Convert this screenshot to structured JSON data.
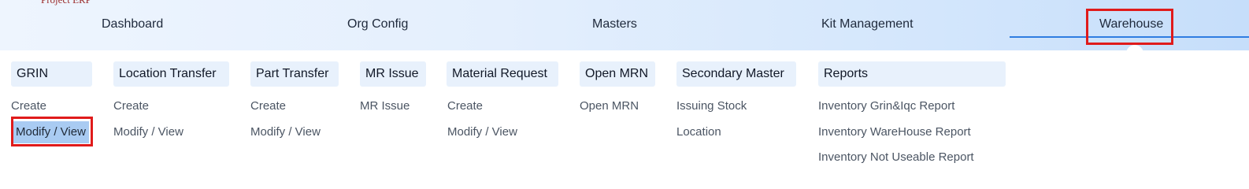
{
  "brand": {
    "logo_text": "Project ERP"
  },
  "nav": {
    "items": [
      {
        "label": "Dashboard"
      },
      {
        "label": "Org Config"
      },
      {
        "label": "Masters"
      },
      {
        "label": "Kit Management"
      },
      {
        "label": "Warehouse",
        "active": true
      }
    ]
  },
  "menu": {
    "groups": [
      {
        "header": "GRIN",
        "links": [
          "Create",
          "Modify / View"
        ]
      },
      {
        "header": "Location Transfer",
        "links": [
          "Create",
          "Modify / View"
        ]
      },
      {
        "header": "Part Transfer",
        "links": [
          "Create",
          "Modify / View"
        ]
      },
      {
        "header": "MR Issue",
        "links": [
          "MR Issue"
        ]
      },
      {
        "header": "Material Request",
        "links": [
          "Create",
          "Modify / View"
        ]
      },
      {
        "header": "Open MRN",
        "links": [
          "Open MRN"
        ]
      },
      {
        "header": "Secondary Master",
        "links": [
          "Issuing Stock",
          "Location"
        ]
      },
      {
        "header": "Reports",
        "links": [
          "Inventory Grin&Iqc Report",
          "Inventory WareHouse Report",
          "Inventory Not Useable Report"
        ]
      }
    ],
    "selected_link": "GRIN / Modify / View"
  },
  "colors": {
    "accent": "#2f7de1",
    "highlight": "#e01b1b",
    "selected_bg": "#a9cbf2",
    "header_bg": "#e8f1fc"
  }
}
